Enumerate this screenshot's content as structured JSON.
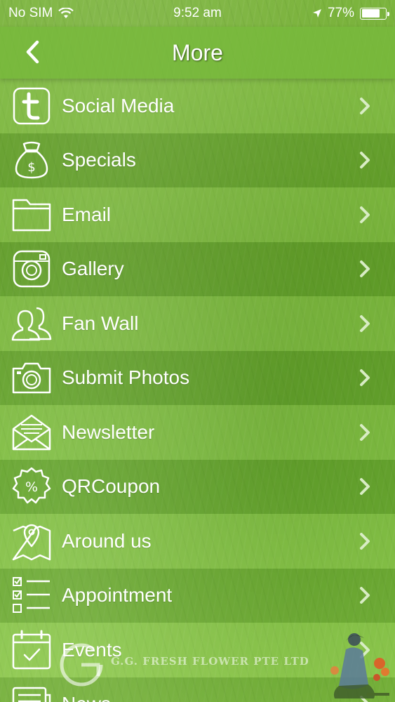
{
  "status_bar": {
    "carrier": "No SIM",
    "time": "9:52 am",
    "battery_percent": "77%",
    "battery_level": 0.77
  },
  "nav": {
    "title": "More",
    "back_icon": "chevron-left-icon"
  },
  "menu": {
    "items": [
      {
        "label": "Social Media",
        "icon": "tumblr-icon"
      },
      {
        "label": "Specials",
        "icon": "money-bag-icon"
      },
      {
        "label": "Email",
        "icon": "folder-icon"
      },
      {
        "label": "Gallery",
        "icon": "instagram-camera-icon"
      },
      {
        "label": "Fan Wall",
        "icon": "users-icon"
      },
      {
        "label": "Submit Photos",
        "icon": "camera-icon"
      },
      {
        "label": "Newsletter",
        "icon": "envelope-icon"
      },
      {
        "label": "QRCoupon",
        "icon": "percent-badge-icon"
      },
      {
        "label": "Around us",
        "icon": "map-pin-icon"
      },
      {
        "label": "Appointment",
        "icon": "checklist-icon"
      },
      {
        "label": "Events",
        "icon": "calendar-check-icon"
      },
      {
        "label": "News",
        "icon": "newspaper-icon"
      }
    ]
  },
  "watermark": {
    "text": "G.G. FRESH FLOWER PTE LTD"
  },
  "colors": {
    "accent": "#7cb43e",
    "text": "#ffffff",
    "chevron": "#d8ecc4"
  }
}
